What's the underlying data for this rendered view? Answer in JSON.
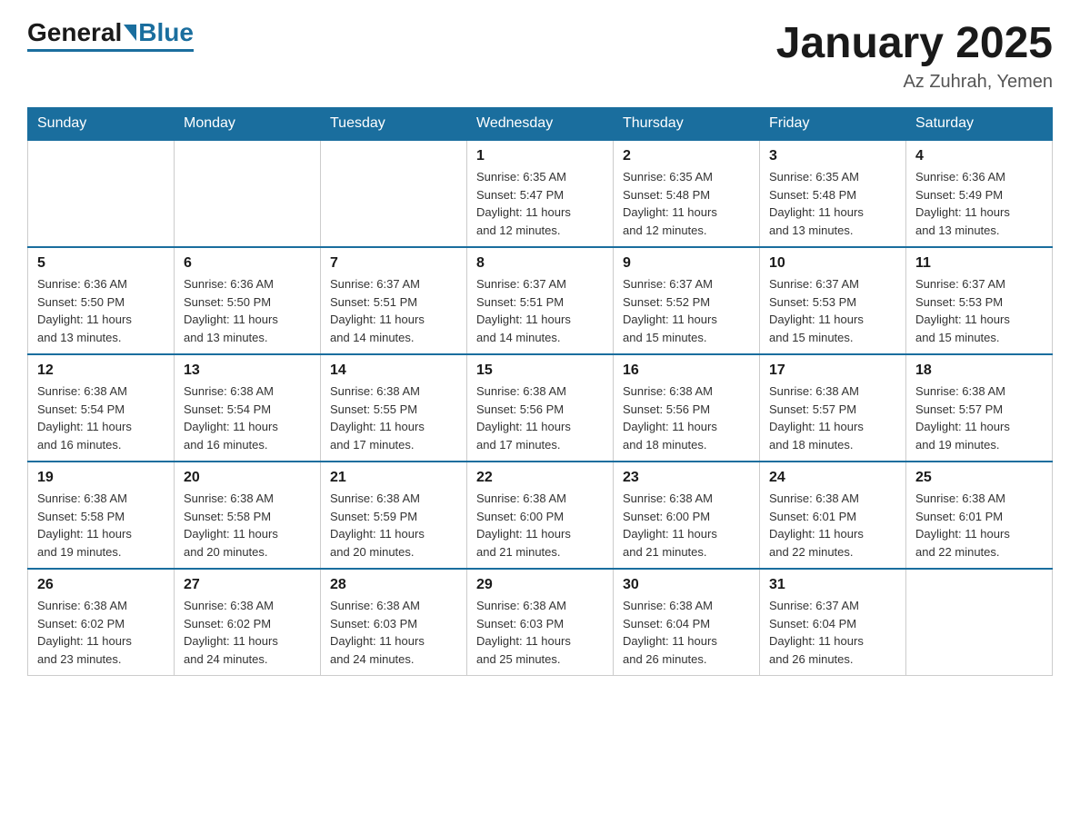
{
  "logo": {
    "general": "General",
    "blue": "Blue"
  },
  "header": {
    "title": "January 2025",
    "location": "Az Zuhrah, Yemen"
  },
  "days_of_week": [
    "Sunday",
    "Monday",
    "Tuesday",
    "Wednesday",
    "Thursday",
    "Friday",
    "Saturday"
  ],
  "weeks": [
    [
      {
        "day": "",
        "info": ""
      },
      {
        "day": "",
        "info": ""
      },
      {
        "day": "",
        "info": ""
      },
      {
        "day": "1",
        "info": "Sunrise: 6:35 AM\nSunset: 5:47 PM\nDaylight: 11 hours\nand 12 minutes."
      },
      {
        "day": "2",
        "info": "Sunrise: 6:35 AM\nSunset: 5:48 PM\nDaylight: 11 hours\nand 12 minutes."
      },
      {
        "day": "3",
        "info": "Sunrise: 6:35 AM\nSunset: 5:48 PM\nDaylight: 11 hours\nand 13 minutes."
      },
      {
        "day": "4",
        "info": "Sunrise: 6:36 AM\nSunset: 5:49 PM\nDaylight: 11 hours\nand 13 minutes."
      }
    ],
    [
      {
        "day": "5",
        "info": "Sunrise: 6:36 AM\nSunset: 5:50 PM\nDaylight: 11 hours\nand 13 minutes."
      },
      {
        "day": "6",
        "info": "Sunrise: 6:36 AM\nSunset: 5:50 PM\nDaylight: 11 hours\nand 13 minutes."
      },
      {
        "day": "7",
        "info": "Sunrise: 6:37 AM\nSunset: 5:51 PM\nDaylight: 11 hours\nand 14 minutes."
      },
      {
        "day": "8",
        "info": "Sunrise: 6:37 AM\nSunset: 5:51 PM\nDaylight: 11 hours\nand 14 minutes."
      },
      {
        "day": "9",
        "info": "Sunrise: 6:37 AM\nSunset: 5:52 PM\nDaylight: 11 hours\nand 15 minutes."
      },
      {
        "day": "10",
        "info": "Sunrise: 6:37 AM\nSunset: 5:53 PM\nDaylight: 11 hours\nand 15 minutes."
      },
      {
        "day": "11",
        "info": "Sunrise: 6:37 AM\nSunset: 5:53 PM\nDaylight: 11 hours\nand 15 minutes."
      }
    ],
    [
      {
        "day": "12",
        "info": "Sunrise: 6:38 AM\nSunset: 5:54 PM\nDaylight: 11 hours\nand 16 minutes."
      },
      {
        "day": "13",
        "info": "Sunrise: 6:38 AM\nSunset: 5:54 PM\nDaylight: 11 hours\nand 16 minutes."
      },
      {
        "day": "14",
        "info": "Sunrise: 6:38 AM\nSunset: 5:55 PM\nDaylight: 11 hours\nand 17 minutes."
      },
      {
        "day": "15",
        "info": "Sunrise: 6:38 AM\nSunset: 5:56 PM\nDaylight: 11 hours\nand 17 minutes."
      },
      {
        "day": "16",
        "info": "Sunrise: 6:38 AM\nSunset: 5:56 PM\nDaylight: 11 hours\nand 18 minutes."
      },
      {
        "day": "17",
        "info": "Sunrise: 6:38 AM\nSunset: 5:57 PM\nDaylight: 11 hours\nand 18 minutes."
      },
      {
        "day": "18",
        "info": "Sunrise: 6:38 AM\nSunset: 5:57 PM\nDaylight: 11 hours\nand 19 minutes."
      }
    ],
    [
      {
        "day": "19",
        "info": "Sunrise: 6:38 AM\nSunset: 5:58 PM\nDaylight: 11 hours\nand 19 minutes."
      },
      {
        "day": "20",
        "info": "Sunrise: 6:38 AM\nSunset: 5:58 PM\nDaylight: 11 hours\nand 20 minutes."
      },
      {
        "day": "21",
        "info": "Sunrise: 6:38 AM\nSunset: 5:59 PM\nDaylight: 11 hours\nand 20 minutes."
      },
      {
        "day": "22",
        "info": "Sunrise: 6:38 AM\nSunset: 6:00 PM\nDaylight: 11 hours\nand 21 minutes."
      },
      {
        "day": "23",
        "info": "Sunrise: 6:38 AM\nSunset: 6:00 PM\nDaylight: 11 hours\nand 21 minutes."
      },
      {
        "day": "24",
        "info": "Sunrise: 6:38 AM\nSunset: 6:01 PM\nDaylight: 11 hours\nand 22 minutes."
      },
      {
        "day": "25",
        "info": "Sunrise: 6:38 AM\nSunset: 6:01 PM\nDaylight: 11 hours\nand 22 minutes."
      }
    ],
    [
      {
        "day": "26",
        "info": "Sunrise: 6:38 AM\nSunset: 6:02 PM\nDaylight: 11 hours\nand 23 minutes."
      },
      {
        "day": "27",
        "info": "Sunrise: 6:38 AM\nSunset: 6:02 PM\nDaylight: 11 hours\nand 24 minutes."
      },
      {
        "day": "28",
        "info": "Sunrise: 6:38 AM\nSunset: 6:03 PM\nDaylight: 11 hours\nand 24 minutes."
      },
      {
        "day": "29",
        "info": "Sunrise: 6:38 AM\nSunset: 6:03 PM\nDaylight: 11 hours\nand 25 minutes."
      },
      {
        "day": "30",
        "info": "Sunrise: 6:38 AM\nSunset: 6:04 PM\nDaylight: 11 hours\nand 26 minutes."
      },
      {
        "day": "31",
        "info": "Sunrise: 6:37 AM\nSunset: 6:04 PM\nDaylight: 11 hours\nand 26 minutes."
      },
      {
        "day": "",
        "info": ""
      }
    ]
  ]
}
